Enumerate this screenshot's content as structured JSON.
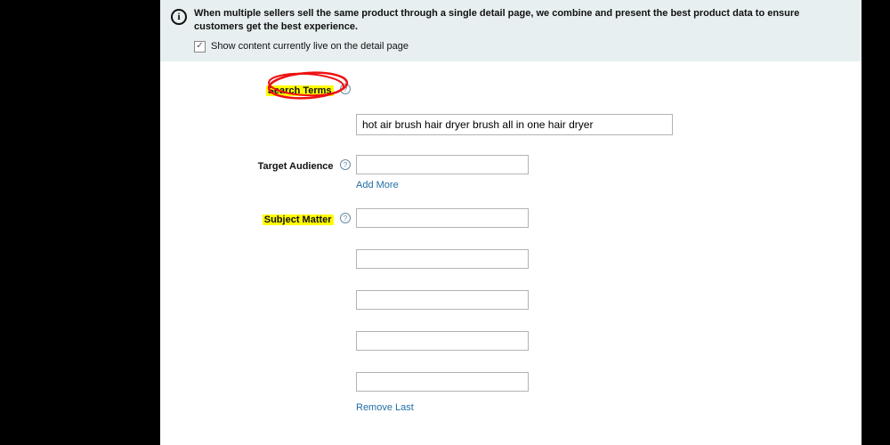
{
  "banner": {
    "text": "When multiple sellers sell the same product through a single detail page, we combine and present the best product data to ensure customers get the best experience.",
    "checkbox_label": "Show content currently live on the detail page",
    "checked": true
  },
  "fields": {
    "search_terms": {
      "label": "Search Terms",
      "value": "hot air brush hair dryer brush all in one hair dryer"
    },
    "target_audience": {
      "label": "Target Audience",
      "value": "",
      "add_more": "Add More"
    },
    "subject_matter": {
      "label": "Subject Matter",
      "values": [
        "",
        "",
        "",
        "",
        ""
      ],
      "remove_last": "Remove Last"
    }
  },
  "icons": {
    "info": "i",
    "help": "?",
    "check": "✓"
  }
}
